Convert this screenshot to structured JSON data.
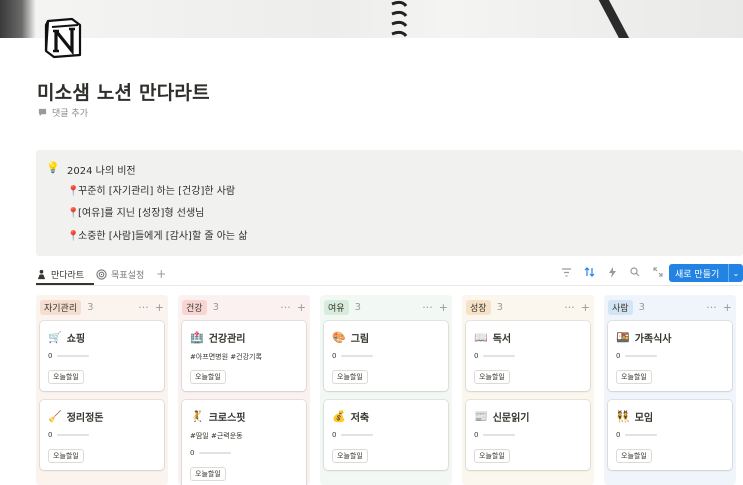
{
  "page": {
    "title": "미소샘 노션 만다라트",
    "add_comment": "댓글 추가",
    "icon": "notion-logo-icon"
  },
  "callout": {
    "icon": "lightbulb-icon",
    "heading": "2024 나의 비전",
    "lines": [
      "꾸준히 [자기관리] 하는 [건강]한 사람",
      "[여유]를 지닌 [성장]형 선생님",
      "소중한 [사람]들에게 [감사]할 줄 아는 삶"
    ],
    "line_icon": "pin-icon"
  },
  "views": {
    "tabs": [
      {
        "label": "만다라트",
        "icon": "person-icon",
        "active": true
      },
      {
        "label": "목표설정",
        "icon": "target-icon",
        "active": false
      }
    ],
    "new_button": "새로 만들기"
  },
  "toolbar": {
    "icons": [
      "filter-icon",
      "sort-icon",
      "automation-icon",
      "search-icon",
      "expand-icon",
      "more-icon"
    ]
  },
  "colors": {
    "accent": "#2383e2",
    "pin": "#e03e3e"
  },
  "board": {
    "today_label": "오늘할일",
    "columns": [
      {
        "name": "자기관리",
        "count": "3",
        "bg": "#fbf3ee",
        "tag_bg": "#f5ddd0",
        "cards": [
          {
            "emoji": "🛒",
            "title": "쇼핑",
            "tags": "",
            "progress": "0",
            "fraction": 0
          },
          {
            "emoji": "🧹",
            "title": "정리정돈",
            "tags": "",
            "progress": "0",
            "fraction": 0
          }
        ]
      },
      {
        "name": "건강",
        "count": "3",
        "bg": "#fbf1f1",
        "tag_bg": "#f8d5d3",
        "cards": [
          {
            "emoji": "🏥",
            "title": "건강관리",
            "tags": "#아프면병원 #건강기록",
            "progress": "",
            "fraction": null
          },
          {
            "emoji": "🤾",
            "title": "크로스핏",
            "tags": "#땀일 #근력운동",
            "progress": "0",
            "fraction": 0
          }
        ]
      },
      {
        "name": "여유",
        "count": "3",
        "bg": "#f2f8f3",
        "tag_bg": "#d8ecdb",
        "cards": [
          {
            "emoji": "🎨",
            "title": "그림",
            "tags": "",
            "progress": "0",
            "fraction": 0
          },
          {
            "emoji": "💰",
            "title": "저축",
            "tags": "",
            "progress": "0",
            "fraction": 0
          }
        ]
      },
      {
        "name": "성장",
        "count": "3",
        "bg": "#fbf6ee",
        "tag_bg": "#f6e2c6",
        "cards": [
          {
            "emoji": "📖",
            "title": "독서",
            "tags": "",
            "progress": "0",
            "fraction": 0
          },
          {
            "emoji": "📰",
            "title": "신문읽기",
            "tags": "",
            "progress": "0",
            "fraction": 0
          }
        ]
      },
      {
        "name": "사람",
        "count": "3",
        "bg": "#eff5fb",
        "tag_bg": "#d3e5f5",
        "cards": [
          {
            "emoji": "🍱",
            "title": "가족식사",
            "tags": "",
            "progress": "0",
            "fraction": 0
          },
          {
            "emoji": "👯",
            "title": "모임",
            "tags": "",
            "progress": "0",
            "fraction": 0
          }
        ]
      }
    ]
  }
}
